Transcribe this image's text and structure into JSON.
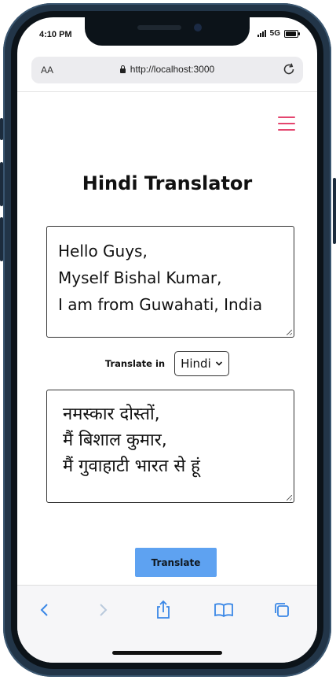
{
  "status_bar": {
    "time": "4:10 PM",
    "network": "5G"
  },
  "browser": {
    "aa_label": "AA",
    "url": "http://localhost:3000"
  },
  "page": {
    "title": "Hindi Translator",
    "source_lines": [
      "Hello Guys,",
      "Myself Bishal Kumar,",
      "I am from Guwahati, India"
    ],
    "translate_label": "Translate in",
    "selected_language": "Hindi",
    "target_lines": [
      "नमस्कार दोस्तों,",
      "मैं बिशाल कुमार,",
      "मैं गुवाहाटी भारत से हूं"
    ],
    "button_label": "Translate"
  },
  "colors": {
    "menu_accent": "#e4466f",
    "button_bg": "#5ea2f1",
    "toolbar_icon": "#3a87e6",
    "frame": "#223548"
  },
  "icons": [
    "menu-icon",
    "lock-icon",
    "reload-icon",
    "back-icon",
    "forward-icon",
    "share-icon",
    "bookmarks-icon",
    "tabs-icon"
  ]
}
